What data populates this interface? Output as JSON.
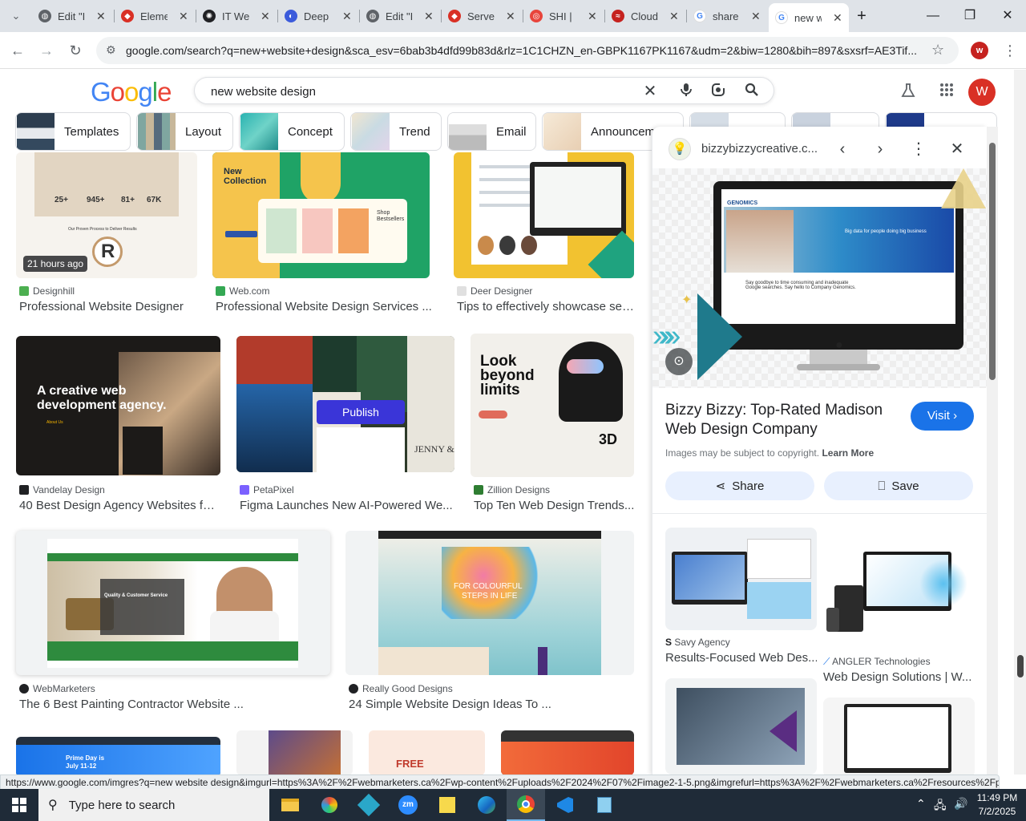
{
  "browser": {
    "tabs": [
      {
        "title": "Edit \"I",
        "favicon_color": "#5f6368"
      },
      {
        "title": "Eleme",
        "favicon_color": "#d93025"
      },
      {
        "title": "IT We",
        "favicon_color": "#202124"
      },
      {
        "title": "Deep",
        "favicon_color": "#3b5bdb"
      },
      {
        "title": "Edit \"I",
        "favicon_color": "#5f6368"
      },
      {
        "title": "Serve",
        "favicon_color": "#d93025"
      },
      {
        "title": "SHI |",
        "favicon_color": "#e8453c"
      },
      {
        "title": "Cloud",
        "favicon_color": "#c5221f"
      },
      {
        "title": "share",
        "favicon_color": "#4285f4"
      },
      {
        "title": "new w",
        "favicon_color": "#4285f4"
      }
    ],
    "tab_close": "✕",
    "new_tab": "+",
    "url": "google.com/search?q=new+website+design&sca_esv=6bab3b4dfd99b83d&rlz=1C1CHZN_en-GBPK1167PK1167&udm=2&biw=1280&bih=897&sxsrf=AE3Tif...",
    "profile_initial": "w"
  },
  "google": {
    "logo": "Google",
    "query": "new website design",
    "avatar_initial": "W",
    "chips": [
      "Templates",
      "Layout",
      "Concept",
      "Trend",
      "Email",
      "Announcem"
    ]
  },
  "results": [
    {
      "source": "Designhill",
      "title": "Professional Website Designer",
      "badge": "21 hours ago",
      "icon_color": "#4caf50",
      "img_text": [
        "25+",
        "945+",
        "81+",
        "67K",
        "Our Proven Process to Deliver Results"
      ]
    },
    {
      "source": "Web.com",
      "title": "Professional Website Design Services ...",
      "icon_color": "#34a853",
      "img_text": [
        "New",
        "Collection",
        "Shop",
        "Bestsellers"
      ]
    },
    {
      "source": "Deer Designer",
      "title": "Tips to effectively showcase ser...",
      "icon_color": "#9aa0a6"
    },
    {
      "source": "Vandelay Design",
      "title": "40 Best Design Agency Websites for...",
      "icon_color": "#202124",
      "img_text": [
        "A creative web",
        "development agency.",
        "About Us"
      ]
    },
    {
      "source": "PetaPixel",
      "title": "Figma Launches New AI-Powered We...",
      "icon_color": "#7b61ff",
      "img_text": [
        "Publish",
        "JENNY &"
      ]
    },
    {
      "source": "Zillion Designs",
      "title": "Top Ten Web Design Trends...",
      "icon_color": "#2e7d32",
      "img_text": [
        "Look",
        "beyond",
        "limits",
        "3D"
      ]
    },
    {
      "source": "WebMarketers",
      "title": "The 6 Best Painting Contractor Website ...",
      "icon_color": "#202124",
      "img_text": [
        "Quality & Customer Service"
      ]
    },
    {
      "source": "Really Good Designs",
      "title": "24 Simple Website Design Ideas To ...",
      "icon_color": "#202124",
      "img_text": [
        "FOR COLOURFUL",
        "STEPS IN LIFE"
      ]
    },
    {
      "source": "",
      "title": "",
      "img_text": [
        "Prime Day is",
        "July 11-12"
      ]
    },
    {
      "source": "",
      "title": "",
      "img_text": [
        "FREE"
      ]
    }
  ],
  "panel": {
    "site": "bizzybizzycreative.c...",
    "title": "Bizzy Bizzy: Top-Rated Madison Web Design Company",
    "visit": "Visit",
    "copyright": "Images may be subject to copyright.",
    "learn_more": "Learn More",
    "share": "Share",
    "save": "Save",
    "img_text": [
      "GENOMICS",
      "Big data for people doing big business",
      "Say goodbye to time consuming and inadequate Google searches. Say hello to Company Genomics."
    ],
    "related": [
      {
        "source": "Savy Agency",
        "title": "Results-Focused Web Des..."
      },
      {
        "source": "ANGLER Technologies",
        "title": "Web Design Solutions | W..."
      }
    ]
  },
  "status_url": "https://www.google.com/imgres?q=new website design&imgurl=https%3A%2F%2Fwebmarketers.ca%2Fwp-content%2Fuploads%2F2024%2F07%2Fimage2-1-5.png&imgrefurl=https%3A%2F%2Fwebmarketers.ca%2Fresources%2Fpa...",
  "taskbar": {
    "search_placeholder": "Type here to search",
    "time": "11:49 PM",
    "date": "7/2/2025"
  }
}
